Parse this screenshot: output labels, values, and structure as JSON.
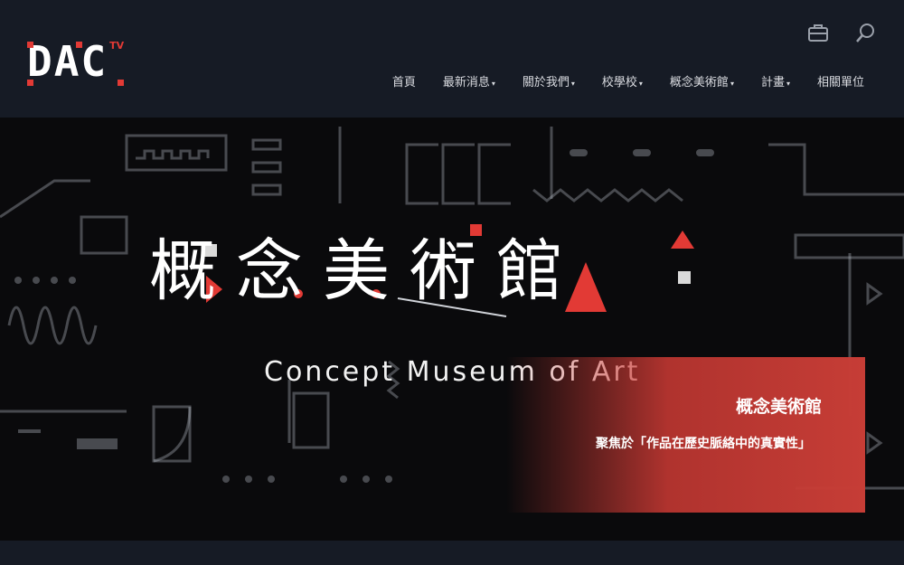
{
  "logo": {
    "text": "DAC",
    "superscript": "TV"
  },
  "utilities": {
    "briefcase_icon": "briefcase-icon",
    "search_icon": "search-icon"
  },
  "nav": {
    "items": [
      {
        "label": "首頁",
        "has_dropdown": false
      },
      {
        "label": "最新消息",
        "has_dropdown": true
      },
      {
        "label": "關於我們",
        "has_dropdown": true
      },
      {
        "label": "校學校",
        "has_dropdown": true
      },
      {
        "label": "概念美術館",
        "has_dropdown": true
      },
      {
        "label": "計畫",
        "has_dropdown": true
      },
      {
        "label": "相關單位",
        "has_dropdown": false
      }
    ],
    "caret": "▾"
  },
  "hero": {
    "title_cn": "概念美術館",
    "title_en": "Concept Museum of Art",
    "caption_title": "概念美術館",
    "caption_subtitle": "聚焦於「作品在歷史脈絡中的真實性」"
  },
  "colors": {
    "accent": "#e23a35",
    "header_bg": "#161b25",
    "hero_bg": "#0a0a0c"
  }
}
